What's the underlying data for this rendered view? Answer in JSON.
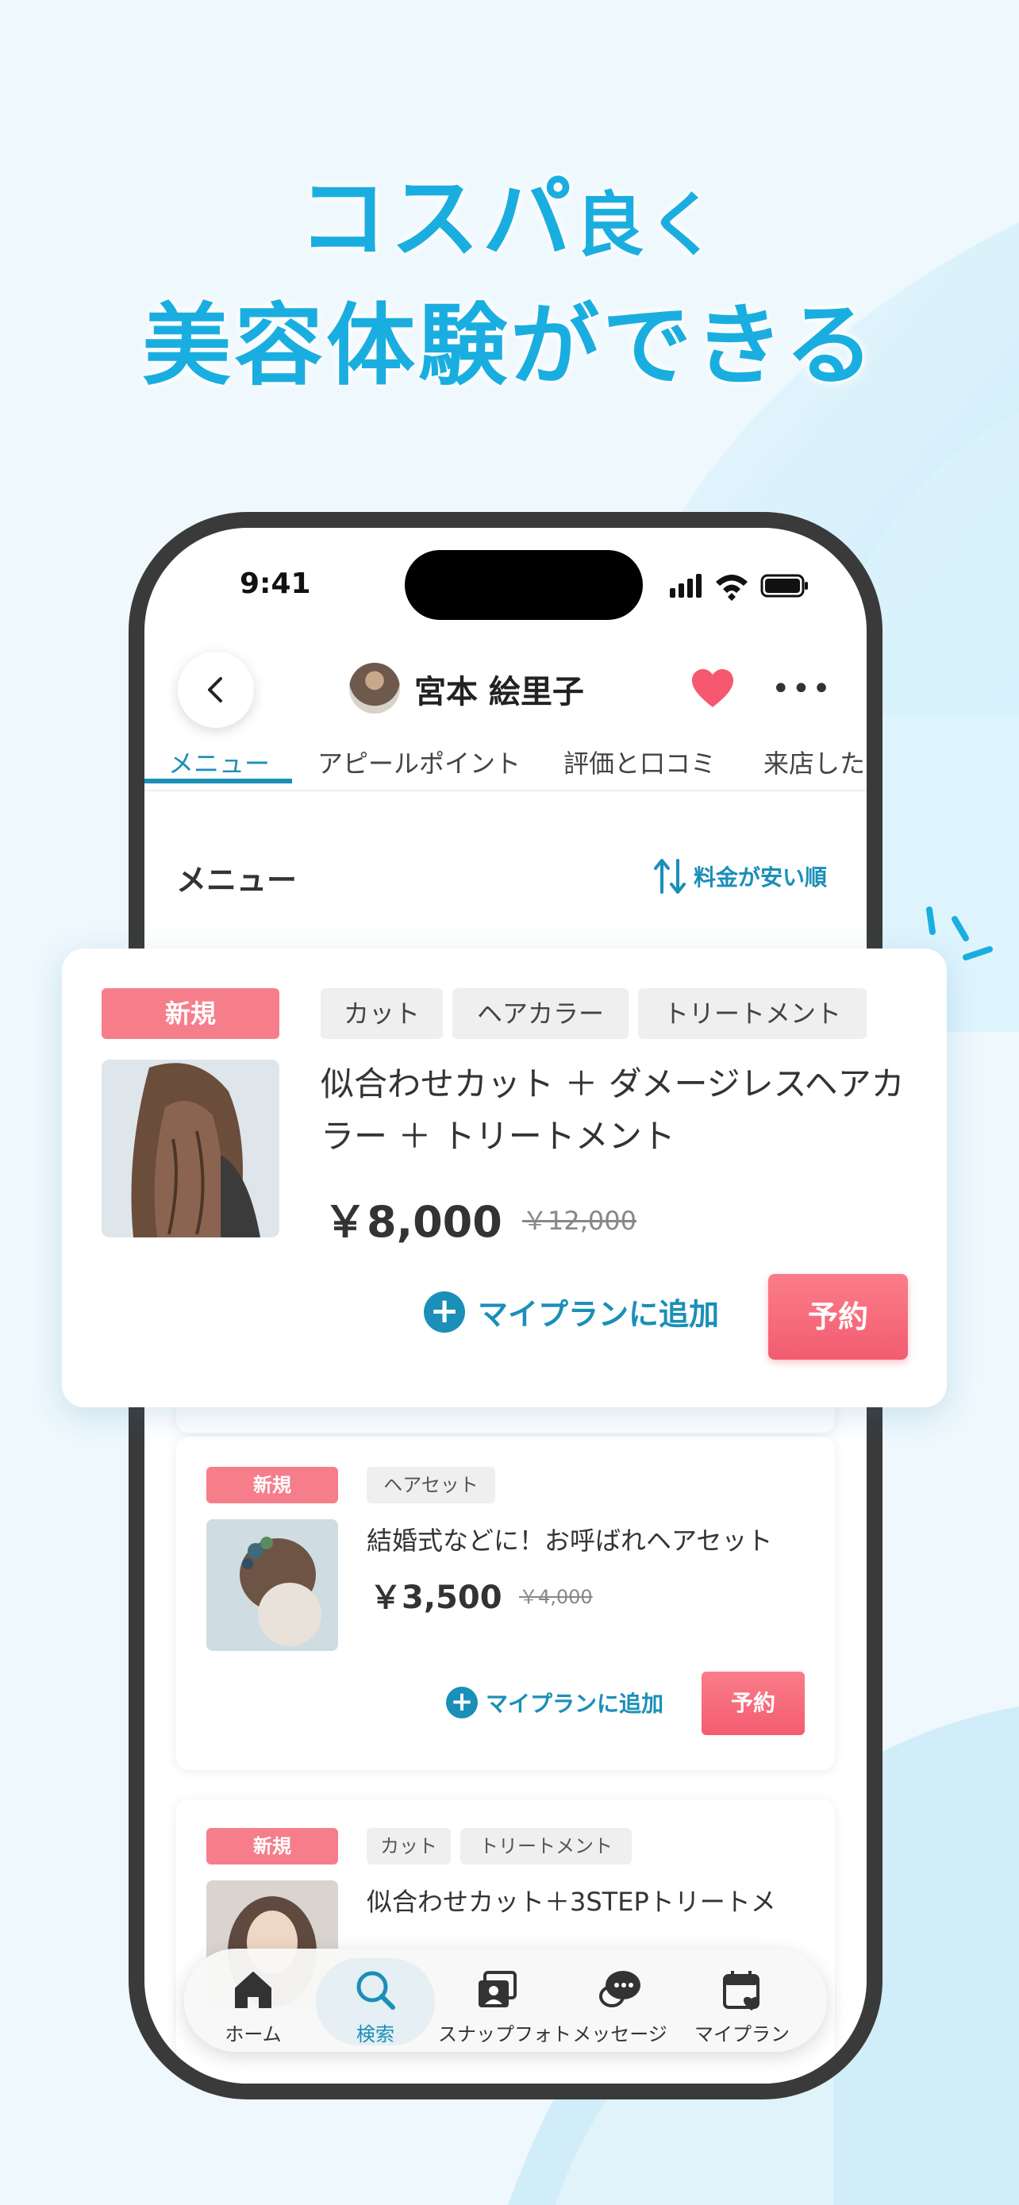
{
  "headline": {
    "line1_main": "コスパ",
    "line1_small": "良く",
    "line2": "美容体験ができる"
  },
  "status": {
    "time": "9:41"
  },
  "profile": {
    "name": "宮本 絵里子"
  },
  "tabs": [
    {
      "label": "メニュー",
      "active": true
    },
    {
      "label": "アピールポイント"
    },
    {
      "label": "評価と口コミ"
    },
    {
      "label": "来店した"
    }
  ],
  "menu_section": {
    "title": "メニュー",
    "sort_label": "料金が安い順"
  },
  "featured_card": {
    "badge": "新規",
    "tags": [
      "カット",
      "ヘアカラー",
      "トリートメント"
    ],
    "title": "似合わせカット ＋ ダメージレスヘアカラー ＋ トリートメント",
    "price": "￥8,000",
    "old_price": "￥12,000",
    "add_plan": "マイプランに追加",
    "reserve": "予約"
  },
  "cards": [
    {
      "badge": "新規",
      "tags": [
        "ヘアセット"
      ],
      "title": "結婚式などに！お呼ばれヘアセット",
      "price": "￥3,500",
      "old_price": "￥4,000",
      "add_plan": "マイプランに追加",
      "reserve": "予約"
    },
    {
      "badge": "新規",
      "tags": [
        "カット",
        "トリートメント"
      ],
      "title": "似合わせカット＋3STEPトリートメ"
    }
  ],
  "tabbar": [
    {
      "label": "ホーム",
      "icon": "home-icon"
    },
    {
      "label": "検索",
      "icon": "search-icon",
      "active": true
    },
    {
      "label": "スナップフォト",
      "icon": "snap-photo-icon"
    },
    {
      "label": "メッセージ",
      "icon": "message-icon"
    },
    {
      "label": "マイプラン",
      "icon": "calendar-heart-icon"
    }
  ],
  "colors": {
    "accent": "#1a8fb8",
    "headline": "#1aaee0",
    "badge": "#f67e8b",
    "reserve": "#f35c70"
  }
}
